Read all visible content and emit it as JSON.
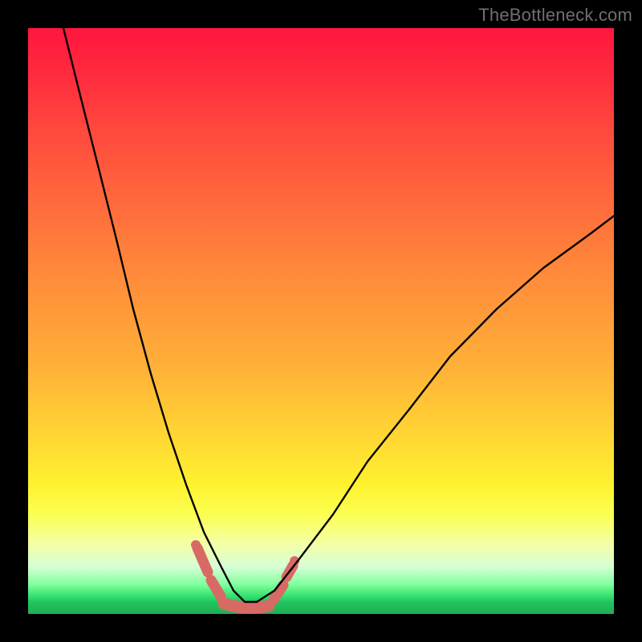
{
  "watermark": "TheBottleneck.com",
  "chart_data": {
    "type": "line",
    "title": "",
    "xlabel": "",
    "ylabel": "",
    "xlim": [
      0,
      100
    ],
    "ylim": [
      0,
      100
    ],
    "series": [
      {
        "name": "bottleneck-curve",
        "x": [
          6,
          9,
          12,
          15,
          18,
          21,
          24,
          27,
          30,
          33,
          35,
          37,
          39,
          42,
          46,
          52,
          58,
          65,
          72,
          80,
          88,
          96,
          100
        ],
        "y": [
          100,
          88,
          76,
          64,
          52,
          41,
          31,
          22,
          14,
          8,
          4,
          2,
          2,
          4,
          9,
          17,
          26,
          35,
          44,
          52,
          59,
          65,
          68
        ]
      },
      {
        "name": "marker-band",
        "x_range": [
          30,
          39
        ],
        "y_range": [
          0,
          8
        ],
        "color": "#d86a66"
      }
    ],
    "colors": {
      "curve": "#000000",
      "marker": "#d86a66",
      "background_top": "#ff163f",
      "background_bottom": "#1eae55"
    }
  }
}
